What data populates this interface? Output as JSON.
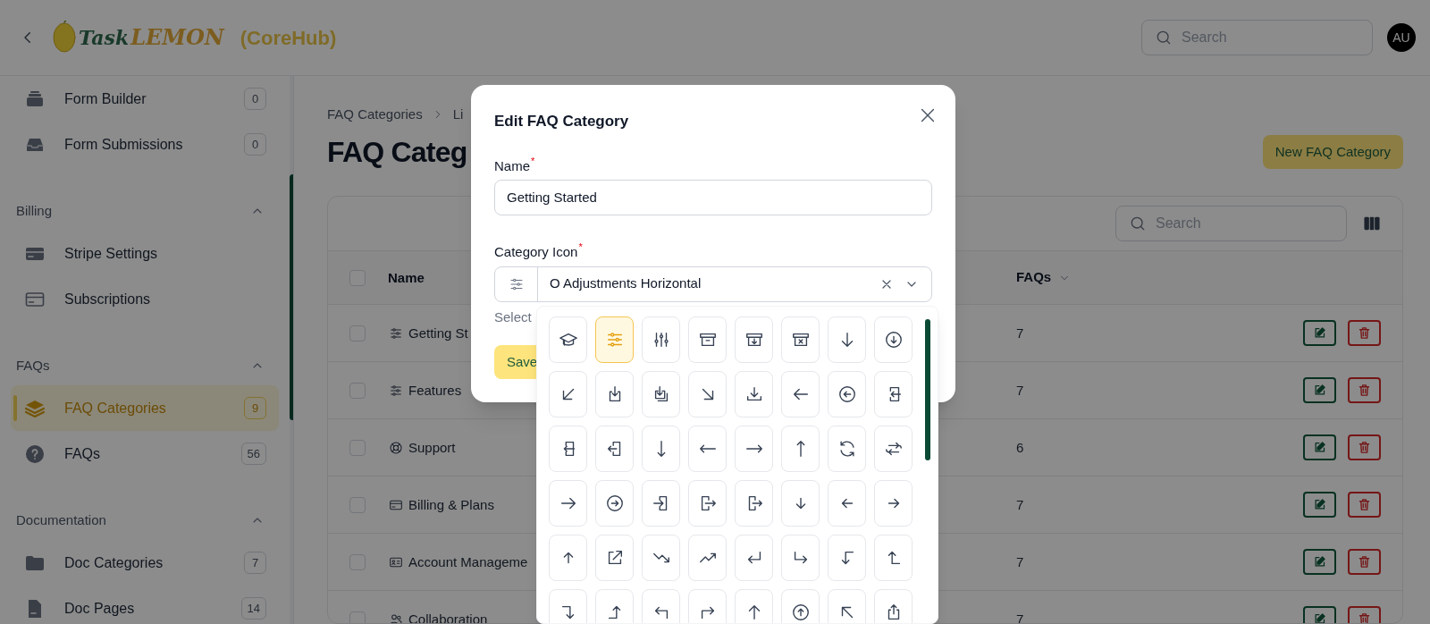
{
  "header": {
    "logo": {
      "word_1": "Task",
      "word_2": "LEMON"
    },
    "org": "(CoreHub)",
    "search": {
      "placeholder": "Search"
    },
    "avatar": "AU"
  },
  "sidebar": {
    "top_items": [
      {
        "label": "Form Builder",
        "badge": "0",
        "selected": false
      },
      {
        "label": "Form Submissions",
        "badge": "0",
        "selected": false
      }
    ],
    "sections": [
      {
        "title": "Billing",
        "expanded": true,
        "items": [
          {
            "label": "Stripe Settings",
            "selected": false
          },
          {
            "label": "Subscriptions",
            "selected": false
          }
        ]
      },
      {
        "title": "FAQs",
        "expanded": true,
        "items": [
          {
            "label": "FAQ Categories",
            "badge": "9",
            "selected": true
          },
          {
            "label": "FAQs",
            "badge": "56",
            "selected": false
          }
        ]
      },
      {
        "title": "Documentation",
        "expanded": true,
        "items": [
          {
            "label": "Doc Categories",
            "badge": "7",
            "selected": false
          },
          {
            "label": "Doc Pages",
            "badge": "14",
            "selected": false
          }
        ]
      }
    ]
  },
  "breadcrumb": [
    "FAQ Categories",
    "Li"
  ],
  "page_title": "FAQ Categ",
  "new_button": "New FAQ Category",
  "table": {
    "search": {
      "placeholder": "Search"
    },
    "columns": [
      "Name",
      "FAQs"
    ],
    "all_checked": false,
    "rows": [
      {
        "name": "Getting St",
        "checked": false,
        "faqs": "7"
      },
      {
        "name": "Features",
        "checked": false,
        "faqs": "7"
      },
      {
        "name": "Support",
        "checked": false,
        "faqs": "6"
      },
      {
        "name": "Billing & Plans",
        "checked": false,
        "faqs": "7"
      },
      {
        "name": "Account Manageme",
        "checked": false,
        "faqs": "7"
      },
      {
        "name": "Collaboration",
        "checked": false,
        "faqs": "7"
      }
    ]
  },
  "modal": {
    "title": "Edit FAQ Category",
    "name_field": {
      "label": "Name",
      "required_mark": "*",
      "value": "Getting Started"
    },
    "icon_field": {
      "label": "Category Icon",
      "required_mark": "*",
      "value": "O Adjustments Horizontal"
    },
    "hint": "Select",
    "save": "Save",
    "icon_options": [
      {
        "selected": false
      },
      {
        "selected": true
      },
      {
        "selected": false
      },
      {
        "selected": false
      },
      {
        "selected": false
      },
      {
        "selected": false
      },
      {
        "selected": false
      },
      {
        "selected": false
      },
      {
        "selected": false
      },
      {
        "selected": false
      },
      {
        "selected": false
      },
      {
        "selected": false
      },
      {
        "selected": false
      },
      {
        "selected": false
      },
      {
        "selected": false
      },
      {
        "selected": false
      },
      {
        "selected": false
      },
      {
        "selected": false
      },
      {
        "selected": false
      },
      {
        "selected": false
      },
      {
        "selected": false
      },
      {
        "selected": false
      },
      {
        "selected": false
      },
      {
        "selected": false
      },
      {
        "selected": false
      },
      {
        "selected": false
      },
      {
        "selected": false
      },
      {
        "selected": false
      },
      {
        "selected": false
      },
      {
        "selected": false
      },
      {
        "selected": false
      },
      {
        "selected": false
      },
      {
        "selected": false
      },
      {
        "selected": false
      },
      {
        "selected": false
      },
      {
        "selected": false
      },
      {
        "selected": false
      },
      {
        "selected": false
      },
      {
        "selected": false
      },
      {
        "selected": false
      },
      {
        "selected": false
      },
      {
        "selected": false
      },
      {
        "selected": false
      },
      {
        "selected": false
      },
      {
        "selected": false
      },
      {
        "selected": false
      },
      {
        "selected": false
      },
      {
        "selected": false
      }
    ]
  }
}
